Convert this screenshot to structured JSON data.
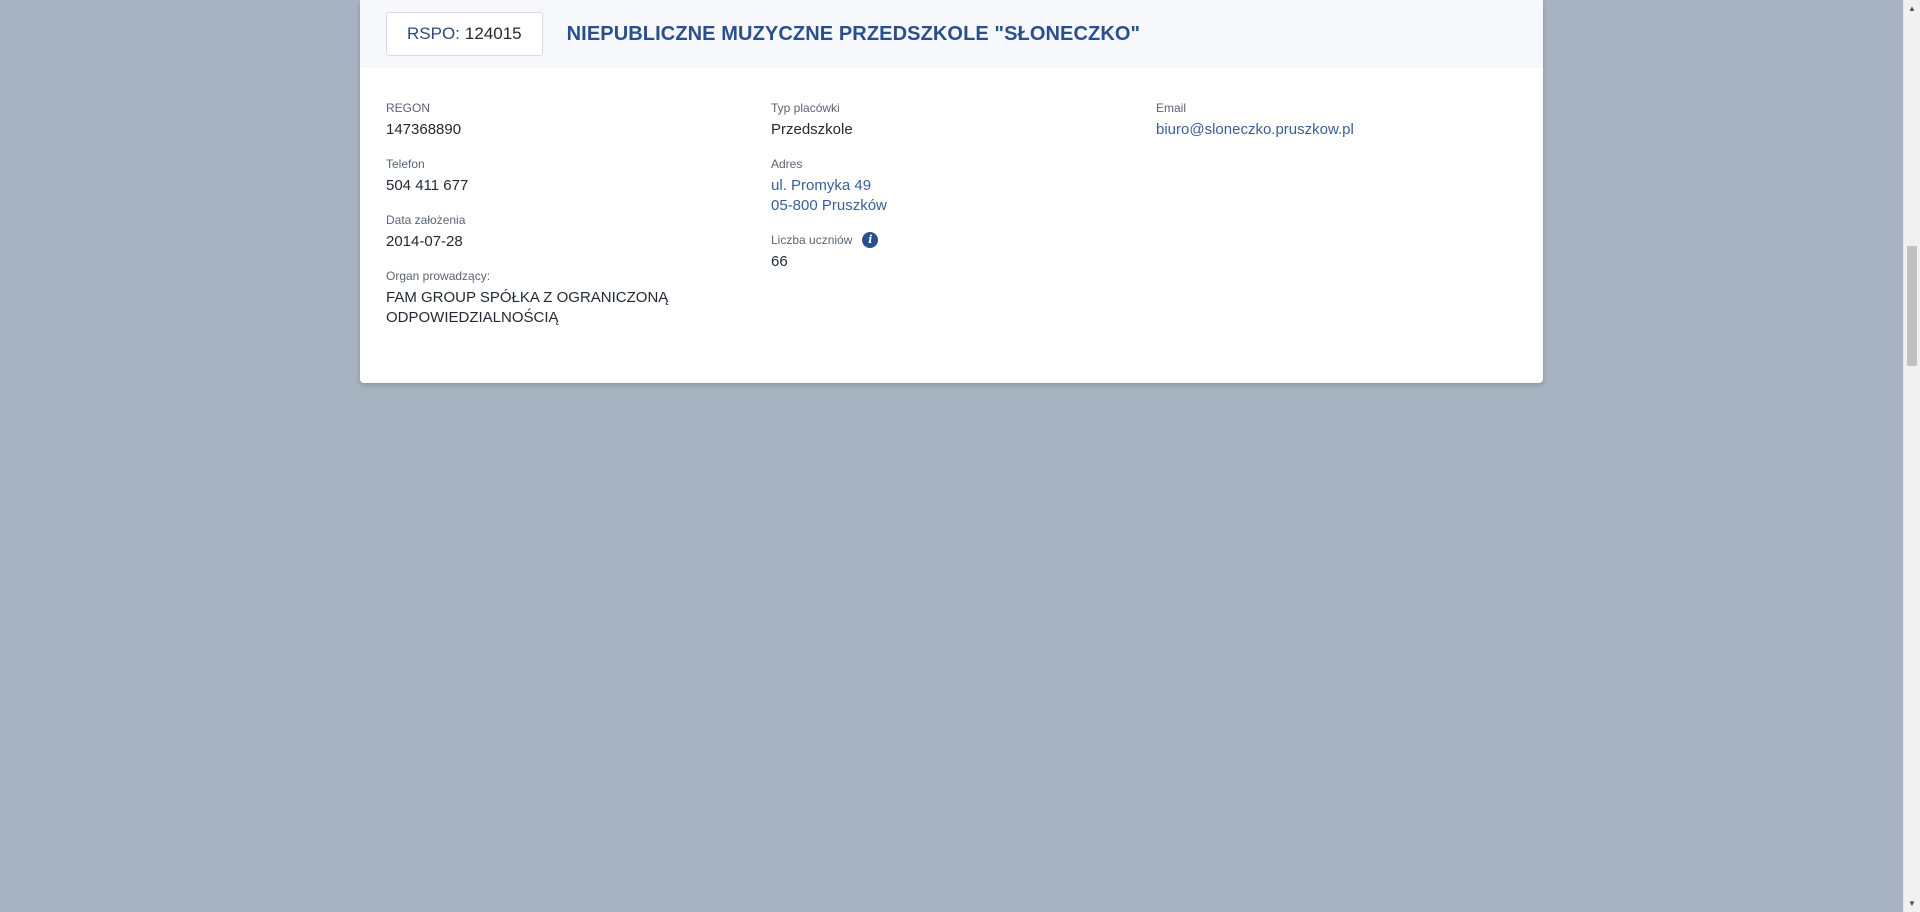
{
  "header": {
    "rspo_label": "RSPO:",
    "rspo_number": "124015",
    "school_name": "NIEPUBLICZNE MUZYCZNE PRZEDSZKOLE \"SŁONECZKO\""
  },
  "details": {
    "regon": {
      "label": "REGON",
      "value": "147368890"
    },
    "telefon": {
      "label": "Telefon",
      "value": "504 411 677"
    },
    "data_zalozenia": {
      "label": "Data założenia",
      "value": "2014-07-28"
    },
    "organ": {
      "label": "Organ prowadzący:",
      "value_line1": "FAM GROUP SPÓŁKA Z OGRANICZONĄ",
      "value_line2": "ODPOWIEDZIALNOŚCIĄ"
    },
    "typ_placowki": {
      "label": "Typ placówki",
      "value": "Przedszkole"
    },
    "adres": {
      "label": "Adres",
      "line1": "ul. Promyka 49",
      "line2": "05-800 Pruszków"
    },
    "liczba_uczniow": {
      "label": "Liczba uczniów",
      "value": "66",
      "icon": "info-icon"
    },
    "email": {
      "label": "Email",
      "value": "biuro@sloneczko.pruszkow.pl"
    }
  },
  "scrollbar": {
    "up_arrow": "▲",
    "down_arrow": "▼"
  },
  "colors": {
    "page_background": "#a8b3c1",
    "accent": "#2a4f8f",
    "link": "#3a5e9a"
  }
}
